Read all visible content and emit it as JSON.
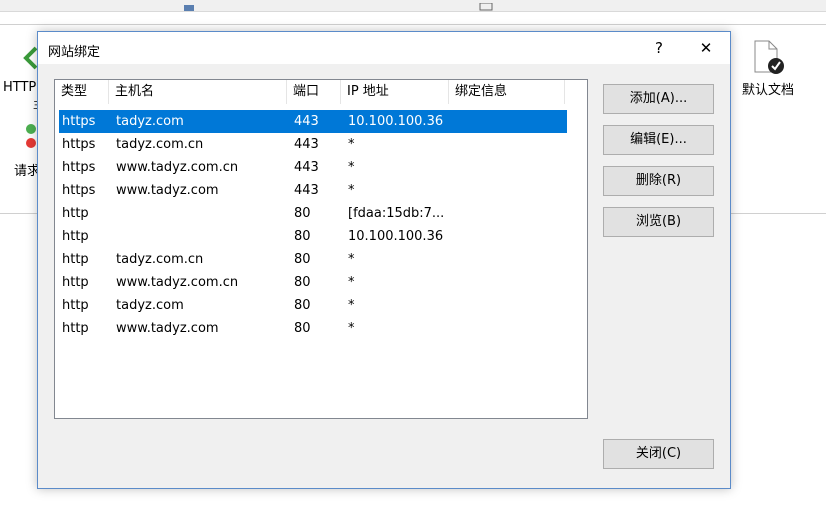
{
  "background": {
    "left_label_1": "HTTP",
    "left_label_2": "请求",
    "right_icon_label": "默认文档"
  },
  "dialog": {
    "title": "网站绑定",
    "help_glyph": "?",
    "close_glyph": "✕",
    "columns": [
      "类型",
      "主机名",
      "端口",
      "IP 地址",
      "绑定信息"
    ],
    "rows": [
      {
        "type": "https",
        "host": "tadyz.com",
        "port": "443",
        "ip": "10.100.100.36",
        "info": "",
        "selected": true
      },
      {
        "type": "https",
        "host": "tadyz.com.cn",
        "port": "443",
        "ip": "*",
        "info": ""
      },
      {
        "type": "https",
        "host": "www.tadyz.com.cn",
        "port": "443",
        "ip": "*",
        "info": ""
      },
      {
        "type": "https",
        "host": "www.tadyz.com",
        "port": "443",
        "ip": "*",
        "info": ""
      },
      {
        "type": "http",
        "host": "",
        "port": "80",
        "ip": "[fdaa:15db:7...",
        "info": ""
      },
      {
        "type": "http",
        "host": "",
        "port": "80",
        "ip": "10.100.100.36",
        "info": ""
      },
      {
        "type": "http",
        "host": "tadyz.com.cn",
        "port": "80",
        "ip": "*",
        "info": ""
      },
      {
        "type": "http",
        "host": "www.tadyz.com.cn",
        "port": "80",
        "ip": "*",
        "info": ""
      },
      {
        "type": "http",
        "host": "tadyz.com",
        "port": "80",
        "ip": "*",
        "info": ""
      },
      {
        "type": "http",
        "host": "www.tadyz.com",
        "port": "80",
        "ip": "*",
        "info": ""
      }
    ],
    "buttons": {
      "add": "添加(A)...",
      "edit": "编辑(E)...",
      "remove": "删除(R)",
      "browse": "浏览(B)",
      "close": "关闭(C)"
    }
  },
  "colors": {
    "selection": "#0078d7",
    "dialog_border": "#5b8bc9",
    "button_face": "#e1e1e1"
  }
}
